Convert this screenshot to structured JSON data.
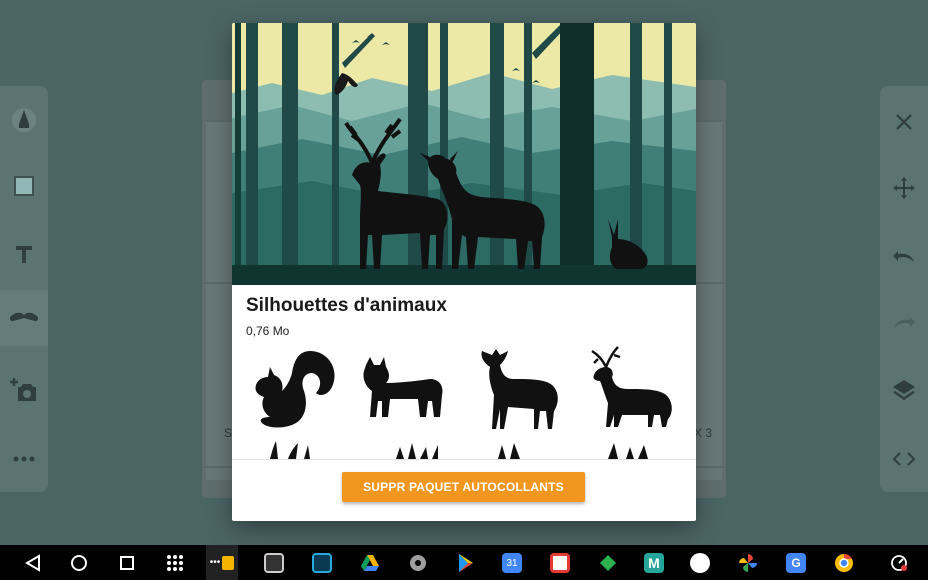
{
  "dialog": {
    "title": "Silhouettes d'animaux",
    "size": "0,76 Mo",
    "action_label": "SUPPR PAQUET AUTOCOLLANTS"
  },
  "background": {
    "text_left": "SI",
    "text_right": "X 3"
  },
  "left_toolbar": [
    "pen-icon",
    "color-swatch-icon",
    "text-icon",
    "mustache-icon",
    "add-photo-icon",
    "more-icon"
  ],
  "right_toolbar": [
    "close-icon",
    "move-icon",
    "undo-icon",
    "redo-icon",
    "layers-icon",
    "code-icon"
  ],
  "colors": {
    "accent": "#f29620",
    "sky": "#ece9a6",
    "forest_dark": "#1e4d4a",
    "forest_mid": "#3b7d76",
    "swatch": "#8fc4c4"
  },
  "navbar": {
    "buttons": [
      "back-icon",
      "home-icon",
      "recents-icon",
      "app-drawer-icon"
    ],
    "apps": [
      "keep-icon",
      "screen-icon",
      "scan-icon",
      "drive-icon",
      "settings-icon",
      "play-store-icon",
      "calendar-icon",
      "slides-icon",
      "feedly-icon",
      "maps-icon",
      "voice-icon",
      "photos-icon",
      "translate-icon",
      "chrome-icon",
      "status-icon"
    ],
    "calendar_day": "31"
  }
}
